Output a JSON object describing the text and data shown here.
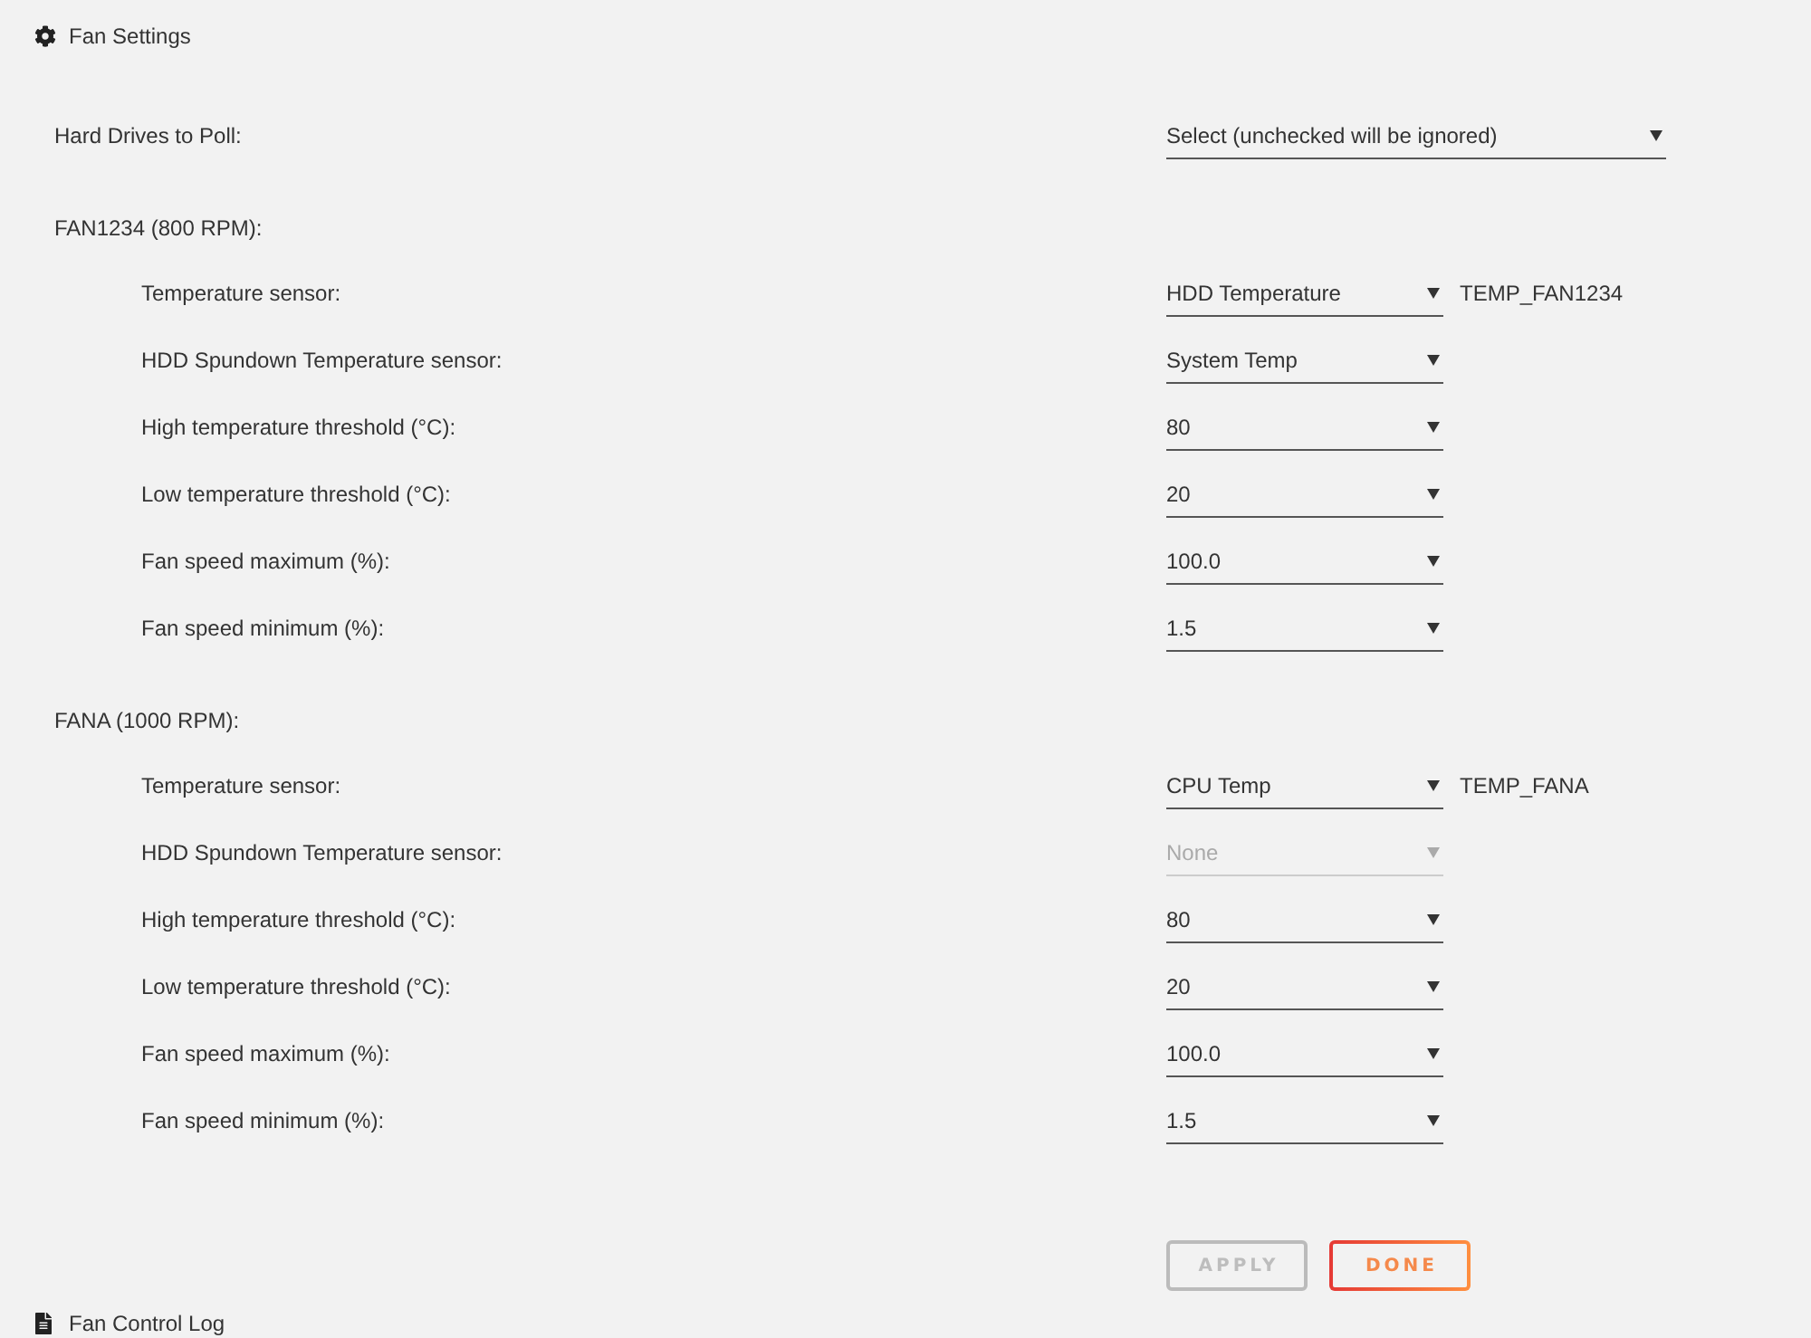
{
  "header": {
    "title": "Fan Settings"
  },
  "drives": {
    "label": "Hard Drives to Poll:",
    "placeholder": "Select (unchecked will be ignored)"
  },
  "fans": [
    {
      "title": "FAN1234 (800 RPM):",
      "settings": [
        {
          "label": "Temperature sensor:",
          "value": "HDD Temperature",
          "note": "TEMP_FAN1234",
          "disabled": false
        },
        {
          "label": "HDD Spundown Temperature sensor:",
          "value": "System Temp",
          "disabled": false
        },
        {
          "label": "High temperature threshold (°C):",
          "value": "80",
          "disabled": false
        },
        {
          "label": "Low temperature threshold (°C):",
          "value": "20",
          "disabled": false
        },
        {
          "label": "Fan speed maximum (%):",
          "value": "100.0",
          "disabled": false
        },
        {
          "label": "Fan speed minimum (%):",
          "value": "1.5",
          "disabled": false
        }
      ]
    },
    {
      "title": "FANA (1000 RPM):",
      "settings": [
        {
          "label": "Temperature sensor:",
          "value": "CPU Temp",
          "note": "TEMP_FANA",
          "disabled": false
        },
        {
          "label": "HDD Spundown Temperature sensor:",
          "value": "None",
          "disabled": true
        },
        {
          "label": "High temperature threshold (°C):",
          "value": "80",
          "disabled": false
        },
        {
          "label": "Low temperature threshold (°C):",
          "value": "20",
          "disabled": false
        },
        {
          "label": "Fan speed maximum (%):",
          "value": "100.0",
          "disabled": false
        },
        {
          "label": "Fan speed minimum (%):",
          "value": "1.5",
          "disabled": false
        }
      ]
    }
  ],
  "buttons": [
    {
      "label": "APPLY",
      "disabled": true
    },
    {
      "label": "DONE",
      "disabled": false
    }
  ],
  "footer": {
    "title": "Fan Control Log"
  }
}
